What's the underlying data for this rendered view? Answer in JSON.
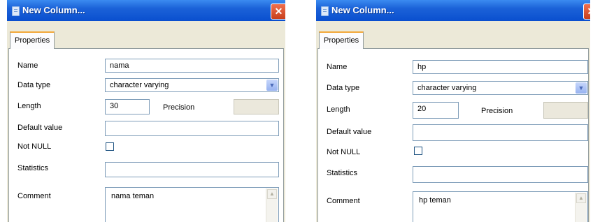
{
  "dialogs": [
    {
      "title": "New Column...",
      "close_glyph": "✕",
      "tab": "Properties",
      "name_label": "Name",
      "name_value": "nama",
      "datatype_label": "Data type",
      "datatype_value": "character varying",
      "length_label": "Length",
      "length_value": "30",
      "precision_label": "Precision",
      "default_label": "Default value",
      "default_value": "",
      "notnull_label": "Not NULL",
      "notnull_checked": false,
      "statistics_label": "Statistics",
      "statistics_value": "",
      "comment_label": "Comment",
      "comment_value": "nama teman"
    },
    {
      "title": "New Column...",
      "close_glyph": "✕",
      "tab": "Properties",
      "name_label": "Name",
      "name_value": "hp",
      "datatype_label": "Data type",
      "datatype_value": "character varying",
      "length_label": "Length",
      "length_value": "20",
      "precision_label": "Precision",
      "default_label": "Default value",
      "default_value": "",
      "notnull_label": "Not NULL",
      "notnull_checked": false,
      "statistics_label": "Statistics",
      "statistics_value": "",
      "comment_label": "Comment",
      "comment_value": "hp teman"
    }
  ],
  "icons": {
    "dropdown": "▼",
    "scroll_up": "▲",
    "window": "window-icon"
  },
  "colors": {
    "titlebar": "#0a4fcf",
    "dialog_bg": "#ece9d8",
    "tab_accent": "#f2a83a",
    "close_button": "#c8401c",
    "field_border": "#7f9db9"
  }
}
